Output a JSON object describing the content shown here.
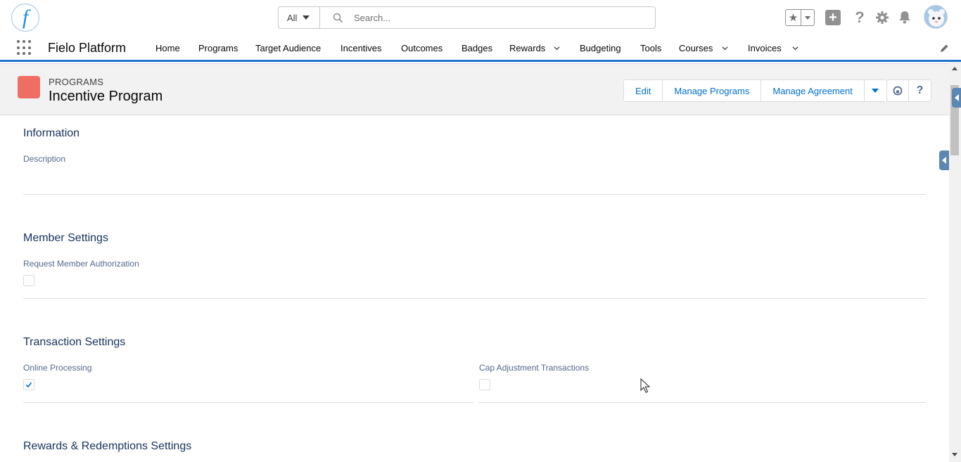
{
  "global_header": {
    "logo_letter": "f",
    "search_scope": "All",
    "search_placeholder": "Search...",
    "icons": [
      "favorites-star-icon",
      "add-icon",
      "help-icon",
      "setup-gear-icon",
      "notifications-bell-icon",
      "user-avatar"
    ]
  },
  "nav": {
    "app_name": "Fielo Platform",
    "items": [
      {
        "label": "Home",
        "has_menu": false
      },
      {
        "label": "Programs",
        "has_menu": false
      },
      {
        "label": "Target Audience",
        "has_menu": false
      },
      {
        "label": "Incentives",
        "has_menu": false
      },
      {
        "label": "Outcomes",
        "has_menu": false
      },
      {
        "label": "Badges",
        "has_menu": false
      },
      {
        "label": "Rewards",
        "has_menu": true
      },
      {
        "label": "Budgeting",
        "has_menu": false
      },
      {
        "label": "Tools",
        "has_menu": false
      },
      {
        "label": "Courses",
        "has_menu": true
      },
      {
        "label": "Invoices",
        "has_menu": true
      }
    ]
  },
  "record": {
    "object_type": "PROGRAMS",
    "title": "Incentive Program",
    "actions": [
      "Edit",
      "Manage Programs",
      "Manage Agreement"
    ]
  },
  "sections": {
    "information": {
      "title": "Information",
      "description_label": "Description",
      "description_value": ""
    },
    "member_settings": {
      "title": "Member Settings",
      "request_member_authorization_label": "Request Member Authorization",
      "request_member_authorization_checked": false
    },
    "transaction_settings": {
      "title": "Transaction Settings",
      "online_processing_label": "Online Processing",
      "online_processing_checked": true,
      "cap_adjustment_label": "Cap Adjustment Transactions",
      "cap_adjustment_checked": false
    },
    "rewards_redemptions": {
      "title": "Rewards & Redemptions Settings"
    }
  },
  "colors": {
    "brand_blue": "#1b73ce",
    "link_blue": "#0070d2",
    "record_icon": "#ef6e64",
    "section_title": "#16325c"
  }
}
